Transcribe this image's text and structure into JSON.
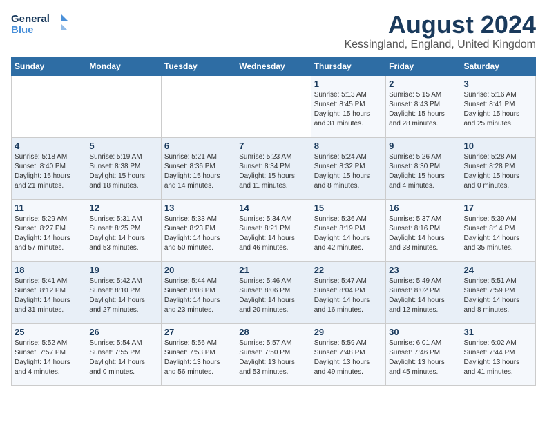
{
  "header": {
    "logo_line1": "General",
    "logo_line2": "Blue",
    "title": "August 2024",
    "subtitle": "Kessingland, England, United Kingdom"
  },
  "days_of_week": [
    "Sunday",
    "Monday",
    "Tuesday",
    "Wednesday",
    "Thursday",
    "Friday",
    "Saturday"
  ],
  "weeks": [
    [
      {
        "day": "",
        "info": ""
      },
      {
        "day": "",
        "info": ""
      },
      {
        "day": "",
        "info": ""
      },
      {
        "day": "",
        "info": ""
      },
      {
        "day": "1",
        "info": "Sunrise: 5:13 AM\nSunset: 8:45 PM\nDaylight: 15 hours\nand 31 minutes."
      },
      {
        "day": "2",
        "info": "Sunrise: 5:15 AM\nSunset: 8:43 PM\nDaylight: 15 hours\nand 28 minutes."
      },
      {
        "day": "3",
        "info": "Sunrise: 5:16 AM\nSunset: 8:41 PM\nDaylight: 15 hours\nand 25 minutes."
      }
    ],
    [
      {
        "day": "4",
        "info": "Sunrise: 5:18 AM\nSunset: 8:40 PM\nDaylight: 15 hours\nand 21 minutes."
      },
      {
        "day": "5",
        "info": "Sunrise: 5:19 AM\nSunset: 8:38 PM\nDaylight: 15 hours\nand 18 minutes."
      },
      {
        "day": "6",
        "info": "Sunrise: 5:21 AM\nSunset: 8:36 PM\nDaylight: 15 hours\nand 14 minutes."
      },
      {
        "day": "7",
        "info": "Sunrise: 5:23 AM\nSunset: 8:34 PM\nDaylight: 15 hours\nand 11 minutes."
      },
      {
        "day": "8",
        "info": "Sunrise: 5:24 AM\nSunset: 8:32 PM\nDaylight: 15 hours\nand 8 minutes."
      },
      {
        "day": "9",
        "info": "Sunrise: 5:26 AM\nSunset: 8:30 PM\nDaylight: 15 hours\nand 4 minutes."
      },
      {
        "day": "10",
        "info": "Sunrise: 5:28 AM\nSunset: 8:28 PM\nDaylight: 15 hours\nand 0 minutes."
      }
    ],
    [
      {
        "day": "11",
        "info": "Sunrise: 5:29 AM\nSunset: 8:27 PM\nDaylight: 14 hours\nand 57 minutes."
      },
      {
        "day": "12",
        "info": "Sunrise: 5:31 AM\nSunset: 8:25 PM\nDaylight: 14 hours\nand 53 minutes."
      },
      {
        "day": "13",
        "info": "Sunrise: 5:33 AM\nSunset: 8:23 PM\nDaylight: 14 hours\nand 50 minutes."
      },
      {
        "day": "14",
        "info": "Sunrise: 5:34 AM\nSunset: 8:21 PM\nDaylight: 14 hours\nand 46 minutes."
      },
      {
        "day": "15",
        "info": "Sunrise: 5:36 AM\nSunset: 8:19 PM\nDaylight: 14 hours\nand 42 minutes."
      },
      {
        "day": "16",
        "info": "Sunrise: 5:37 AM\nSunset: 8:16 PM\nDaylight: 14 hours\nand 38 minutes."
      },
      {
        "day": "17",
        "info": "Sunrise: 5:39 AM\nSunset: 8:14 PM\nDaylight: 14 hours\nand 35 minutes."
      }
    ],
    [
      {
        "day": "18",
        "info": "Sunrise: 5:41 AM\nSunset: 8:12 PM\nDaylight: 14 hours\nand 31 minutes."
      },
      {
        "day": "19",
        "info": "Sunrise: 5:42 AM\nSunset: 8:10 PM\nDaylight: 14 hours\nand 27 minutes."
      },
      {
        "day": "20",
        "info": "Sunrise: 5:44 AM\nSunset: 8:08 PM\nDaylight: 14 hours\nand 23 minutes."
      },
      {
        "day": "21",
        "info": "Sunrise: 5:46 AM\nSunset: 8:06 PM\nDaylight: 14 hours\nand 20 minutes."
      },
      {
        "day": "22",
        "info": "Sunrise: 5:47 AM\nSunset: 8:04 PM\nDaylight: 14 hours\nand 16 minutes."
      },
      {
        "day": "23",
        "info": "Sunrise: 5:49 AM\nSunset: 8:02 PM\nDaylight: 14 hours\nand 12 minutes."
      },
      {
        "day": "24",
        "info": "Sunrise: 5:51 AM\nSunset: 7:59 PM\nDaylight: 14 hours\nand 8 minutes."
      }
    ],
    [
      {
        "day": "25",
        "info": "Sunrise: 5:52 AM\nSunset: 7:57 PM\nDaylight: 14 hours\nand 4 minutes."
      },
      {
        "day": "26",
        "info": "Sunrise: 5:54 AM\nSunset: 7:55 PM\nDaylight: 14 hours\nand 0 minutes."
      },
      {
        "day": "27",
        "info": "Sunrise: 5:56 AM\nSunset: 7:53 PM\nDaylight: 13 hours\nand 56 minutes."
      },
      {
        "day": "28",
        "info": "Sunrise: 5:57 AM\nSunset: 7:50 PM\nDaylight: 13 hours\nand 53 minutes."
      },
      {
        "day": "29",
        "info": "Sunrise: 5:59 AM\nSunset: 7:48 PM\nDaylight: 13 hours\nand 49 minutes."
      },
      {
        "day": "30",
        "info": "Sunrise: 6:01 AM\nSunset: 7:46 PM\nDaylight: 13 hours\nand 45 minutes."
      },
      {
        "day": "31",
        "info": "Sunrise: 6:02 AM\nSunset: 7:44 PM\nDaylight: 13 hours\nand 41 minutes."
      }
    ]
  ]
}
